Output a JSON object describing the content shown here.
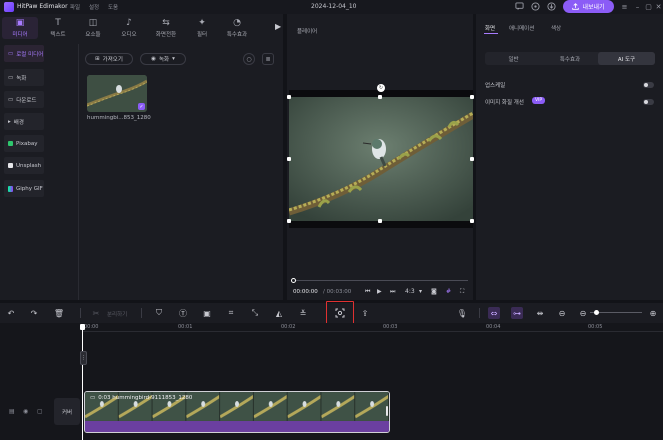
{
  "titlebar": {
    "app_name": "HitPaw Edimakor",
    "menu": [
      "파일",
      "설정",
      "도움"
    ],
    "project_date": "2024-12-04_10",
    "export_label": "내보내기"
  },
  "tool_tabs": [
    {
      "label": "미디어",
      "icon": "media-icon",
      "glyph": "▣"
    },
    {
      "label": "텍스트",
      "icon": "text-icon",
      "glyph": "T"
    },
    {
      "label": "요소들",
      "icon": "elements-icon",
      "glyph": "◫"
    },
    {
      "label": "오디오",
      "icon": "audio-icon",
      "glyph": "♪"
    },
    {
      "label": "화면전환",
      "icon": "transition-icon",
      "glyph": "⇆"
    },
    {
      "label": "필터",
      "icon": "filter-icon",
      "glyph": "✦"
    },
    {
      "label": "특수효과",
      "icon": "effects-icon",
      "glyph": "◔"
    }
  ],
  "sidebar": {
    "items": [
      "로컬 미디어",
      "녹화",
      "다운로드",
      "배경",
      "Pixabay",
      "Unsplash",
      "Giphy GIF"
    ]
  },
  "media": {
    "import_label": "가져오기",
    "record_label": "녹화",
    "thumb_label": "hummingbi...853_1280"
  },
  "preview": {
    "title": "플레이어",
    "time_current": "00:00:00",
    "time_total": "/ 00:03:00",
    "ratio": "4:3"
  },
  "right_panel": {
    "tabs": [
      "화면",
      "애니메이션",
      "색상"
    ],
    "sub_tabs": [
      "일반",
      "특수효과",
      "AI 도구"
    ],
    "options": [
      "업스케일",
      "이미지 화질 개선"
    ],
    "vip_badge": "VIP"
  },
  "toolbar": {
    "split_label": "분리하기"
  },
  "timeline": {
    "ruler": [
      "00:00",
      "00:01",
      "00:02",
      "00:03",
      "00:04",
      "00:05"
    ],
    "cover_label": "커버",
    "clip_label": "0:03 hummingbird-9111853_1280"
  },
  "colors": {
    "accent": "#8b5cf6",
    "highlight_box": "#e03131",
    "audio_track": "#6b3fa0"
  }
}
